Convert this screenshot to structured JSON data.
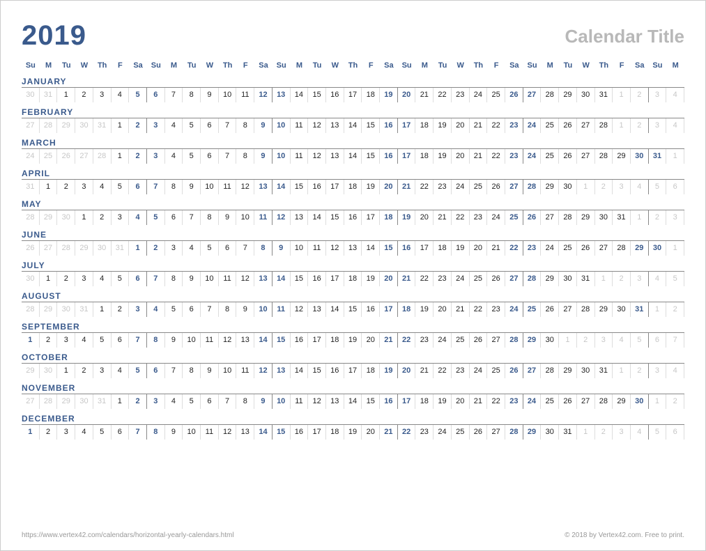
{
  "year": "2019",
  "title": "Calendar Title",
  "day_headers": [
    "Su",
    "M",
    "Tu",
    "W",
    "Th",
    "F",
    "Sa",
    "Su",
    "M",
    "Tu",
    "W",
    "Th",
    "F",
    "Sa",
    "Su",
    "M",
    "Tu",
    "W",
    "Th",
    "F",
    "Sa",
    "Su",
    "M",
    "Tu",
    "W",
    "Th",
    "F",
    "Sa",
    "Su",
    "M",
    "Tu",
    "W",
    "Th",
    "F",
    "Sa",
    "Su",
    "M"
  ],
  "months": [
    {
      "name": "JANUARY",
      "leading": [
        30,
        31
      ],
      "ndays": 31,
      "trailing": [
        1,
        2,
        3,
        4
      ]
    },
    {
      "name": "FEBRUARY",
      "leading": [
        27,
        28,
        29,
        30,
        31
      ],
      "ndays": 28,
      "trailing": [
        1,
        2,
        3,
        4
      ]
    },
    {
      "name": "MARCH",
      "leading": [
        24,
        25,
        26,
        27,
        28
      ],
      "ndays": 31,
      "trailing": [
        1
      ]
    },
    {
      "name": "APRIL",
      "leading": [
        31
      ],
      "ndays": 30,
      "trailing": [
        1,
        2,
        3,
        4,
        5,
        6
      ]
    },
    {
      "name": "MAY",
      "leading": [
        28,
        29,
        30
      ],
      "ndays": 31,
      "trailing": [
        1,
        2,
        3
      ]
    },
    {
      "name": "JUNE",
      "leading": [
        26,
        27,
        28,
        29,
        30,
        31
      ],
      "ndays": 30,
      "trailing": [
        1
      ]
    },
    {
      "name": "JULY",
      "leading": [
        30
      ],
      "ndays": 31,
      "trailing": [
        1,
        2,
        3,
        4,
        5
      ]
    },
    {
      "name": "AUGUST",
      "leading": [
        28,
        29,
        30,
        31
      ],
      "ndays": 31,
      "trailing": [
        1,
        2
      ]
    },
    {
      "name": "SEPTEMBER",
      "leading": [],
      "ndays": 30,
      "trailing": [
        1,
        2,
        3,
        4,
        5,
        6,
        7
      ]
    },
    {
      "name": "OCTOBER",
      "leading": [
        29,
        30
      ],
      "ndays": 31,
      "trailing": [
        1,
        2,
        3,
        4
      ]
    },
    {
      "name": "NOVEMBER",
      "leading": [
        27,
        28,
        29,
        30,
        31
      ],
      "ndays": 30,
      "trailing": [
        1,
        2
      ]
    },
    {
      "name": "DECEMBER",
      "leading": [],
      "ndays": 31,
      "trailing": [
        1,
        2,
        3,
        4,
        5,
        6
      ]
    }
  ],
  "footer": {
    "url": "https://www.vertex42.com/calendars/horizontal-yearly-calendars.html",
    "copyright": "© 2018 by Vertex42.com. Free to print."
  }
}
